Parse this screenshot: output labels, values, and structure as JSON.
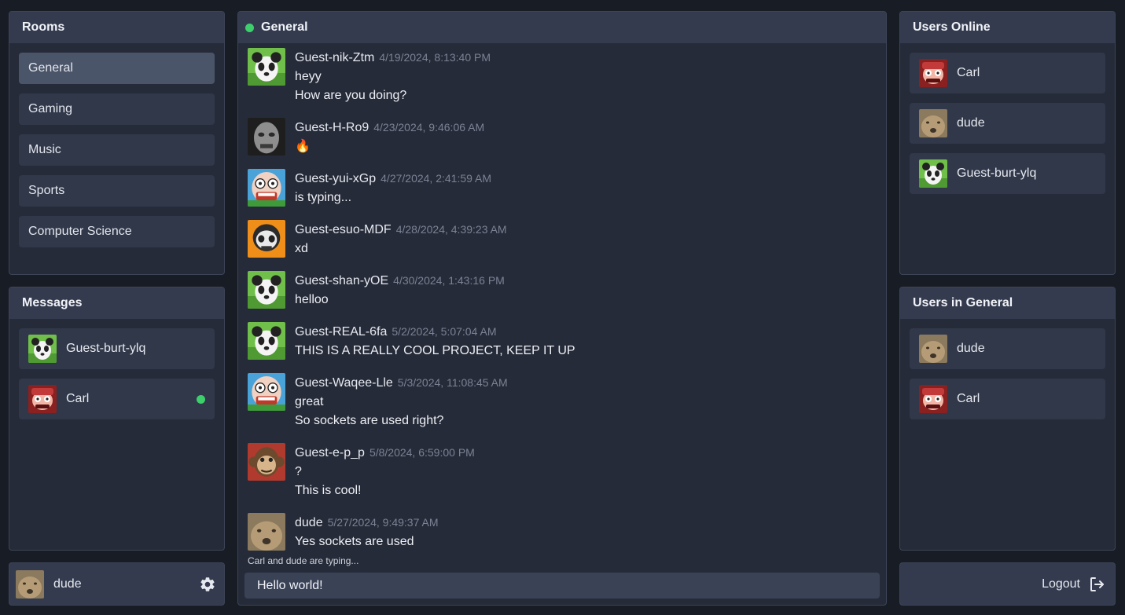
{
  "rooms": {
    "title": "Rooms",
    "items": [
      {
        "label": "General",
        "active": true
      },
      {
        "label": "Gaming"
      },
      {
        "label": "Music"
      },
      {
        "label": "Sports"
      },
      {
        "label": "Computer Science"
      }
    ]
  },
  "direct_messages": {
    "title": "Messages",
    "items": [
      {
        "name": "Guest-burt-ylq",
        "avatar": "panda-avatar-icon"
      },
      {
        "name": "Carl",
        "avatar": "cartoon-pirate-avatar-icon",
        "online": true
      }
    ]
  },
  "current_user": {
    "name": "dude",
    "avatar": "dog-photo-avatar-icon",
    "settings_icon": "gear-icon"
  },
  "chat": {
    "room_name": "General",
    "status_color": "#3ecf6d",
    "messages": [
      {
        "author": "Guest-nik-Ztm",
        "time": "4/19/2024, 8:13:40 PM",
        "avatar": "panda-avatar-icon",
        "lines": [
          "heyy",
          "How are you doing?"
        ]
      },
      {
        "author": "Guest-H-Ro9",
        "time": "4/23/2024, 9:46:06 AM",
        "avatar": "monster-face-avatar-icon",
        "lines": [
          "🔥"
        ]
      },
      {
        "author": "Guest-yui-xGp",
        "time": "4/27/2024, 2:41:59 AM",
        "avatar": "zombie-cartoon-avatar-icon",
        "lines": [
          "is typing..."
        ]
      },
      {
        "author": "Guest-esuo-MDF",
        "time": "4/28/2024, 4:39:23 AM",
        "avatar": "skull-avatar-icon",
        "lines": [
          "xd"
        ]
      },
      {
        "author": "Guest-shan-yOE",
        "time": "4/30/2024, 1:43:16 PM",
        "avatar": "panda-avatar-icon",
        "lines": [
          "helloo"
        ]
      },
      {
        "author": "Guest-REAL-6fa",
        "time": "5/2/2024, 5:07:04 AM",
        "avatar": "panda-avatar-icon",
        "lines": [
          "THIS IS A REALLY COOL PROJECT, KEEP IT UP"
        ]
      },
      {
        "author": "Guest-Waqee-Lle",
        "time": "5/3/2024, 11:08:45 AM",
        "avatar": "zombie-cartoon-avatar-icon",
        "lines": [
          "great",
          "So sockets are used right?"
        ]
      },
      {
        "author": "Guest-e-p_p",
        "time": "5/8/2024, 6:59:00 PM",
        "avatar": "monkey-avatar-icon",
        "lines": [
          "?",
          "This is cool!"
        ]
      },
      {
        "author": "dude",
        "time": "5/27/2024, 9:49:37 AM",
        "avatar": "dog-photo-avatar-icon",
        "lines": [
          "Yes sockets are used"
        ]
      }
    ],
    "typing_indicator": "Carl and dude are typing...",
    "input_value": "Hello world!"
  },
  "users_online": {
    "title": "Users Online",
    "items": [
      {
        "name": "Carl",
        "avatar": "cartoon-pirate-avatar-icon"
      },
      {
        "name": "dude",
        "avatar": "dog-photo-avatar-icon"
      },
      {
        "name": "Guest-burt-ylq",
        "avatar": "panda-avatar-icon"
      }
    ]
  },
  "users_in_room": {
    "title": "Users in General",
    "items": [
      {
        "name": "dude",
        "avatar": "dog-photo-avatar-icon"
      },
      {
        "name": "Carl",
        "avatar": "cartoon-pirate-avatar-icon"
      }
    ]
  },
  "logout": {
    "label": "Logout",
    "icon": "logout-icon"
  }
}
